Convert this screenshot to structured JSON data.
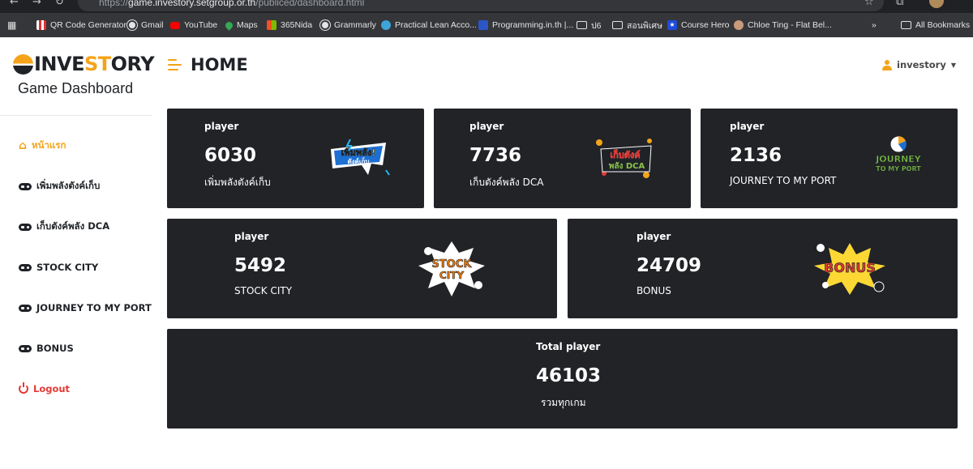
{
  "browser": {
    "url_prefix": "https://",
    "url_host": "game.investory.setgroup.or.th",
    "url_path": "/publiced/dashboard.html",
    "bookmarks": [
      {
        "label": "QR Code Generator",
        "icon": "qr-icon"
      },
      {
        "label": "Gmail",
        "icon": "globe-icon"
      },
      {
        "label": "YouTube",
        "icon": "youtube-icon"
      },
      {
        "label": "Maps",
        "icon": "maps-icon"
      },
      {
        "label": "365Nida",
        "icon": "nida-icon"
      },
      {
        "label": "Grammarly",
        "icon": "globe-icon"
      },
      {
        "label": "Practical Lean Acco...",
        "icon": "lean-icon"
      },
      {
        "label": "Programming.in.th |...",
        "icon": "programming-icon"
      },
      {
        "label": "ป6",
        "icon": "folder-icon"
      },
      {
        "label": "สอนพิเศษ",
        "icon": "folder-icon"
      },
      {
        "label": "Course Hero",
        "icon": "course-hero-icon"
      },
      {
        "label": "Chloe Ting - Flat Bel...",
        "icon": "chloe-icon"
      }
    ],
    "more_label": "»",
    "all_bookmarks_label": "All Bookmarks"
  },
  "sidebar": {
    "logo_part1": "INVE",
    "logo_part2": "ST",
    "logo_part3": "ORY",
    "subtitle": "Game Dashboard",
    "items": [
      {
        "label": "หน้าแรก",
        "icon": "home-icon",
        "active": true
      },
      {
        "label": "เพิ่มพลังตังค์เก็บ",
        "icon": "gamepad-icon"
      },
      {
        "label": "เก็บตังค์พลัง DCA",
        "icon": "gamepad-icon"
      },
      {
        "label": "STOCK CITY",
        "icon": "gamepad-icon"
      },
      {
        "label": "JOURNEY TO MY PORT",
        "icon": "gamepad-icon"
      },
      {
        "label": "BONUS",
        "icon": "gamepad-icon"
      }
    ],
    "logout_label": "Logout"
  },
  "header": {
    "title": "HOME",
    "username": "investory"
  },
  "cards": [
    {
      "label": "player",
      "count": "6030",
      "name": "เพิ่มพลังตังค์เก็บ",
      "badge_text": "เพิ่มพลัง!",
      "badge_sub": "ตังค์เก็บ"
    },
    {
      "label": "player",
      "count": "7736",
      "name": "เก็บตังค์พลัง DCA",
      "badge_text": "เก็บตังค์",
      "badge_sub": "พลัง DCA"
    },
    {
      "label": "player",
      "count": "2136",
      "name": "JOURNEY TO MY PORT",
      "badge_text": "JOURNEY",
      "badge_sub": "TO MY PORT"
    },
    {
      "label": "player",
      "count": "5492",
      "name": "STOCK CITY",
      "badge_text": "STOCK",
      "badge_sub": "CITY"
    },
    {
      "label": "player",
      "count": "24709",
      "name": "BONUS",
      "badge_text": "BONUS",
      "badge_sub": ""
    }
  ],
  "total": {
    "label": "Total player",
    "count": "46103",
    "name": "รวมทุกเกม"
  },
  "colors": {
    "accent": "#f5a31a",
    "card_bg": "#212327",
    "logout": "#e53935"
  }
}
